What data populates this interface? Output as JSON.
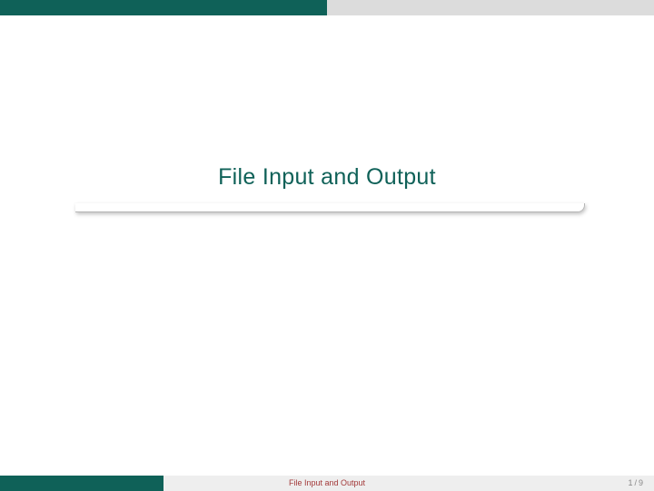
{
  "slide": {
    "title": "File Input and Output"
  },
  "footer": {
    "title": "File Input and Output",
    "page_current": "1",
    "page_separator": "/",
    "page_total": "9"
  },
  "progress": {
    "bar_percent": 50
  },
  "colors": {
    "accent": "#0f6158",
    "footer_title": "#a33a3a"
  }
}
